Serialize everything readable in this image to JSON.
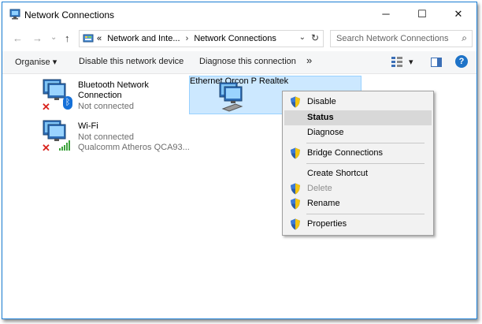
{
  "window": {
    "title": "Network Connections",
    "minimize": "─",
    "maximize": "☐",
    "close": "✕"
  },
  "nav": {
    "back": "←",
    "forward": "→",
    "dropdown": "⌄",
    "up": "↑"
  },
  "address": {
    "overflow": "«",
    "crumbs": [
      "Network and Inte...",
      "Network Connections"
    ],
    "separator": "›",
    "dropdown": "⌄",
    "refresh": "↻"
  },
  "search": {
    "placeholder": "Search Network Connections",
    "icon": "search-icon"
  },
  "toolbar": {
    "organise": "Organise ▾",
    "disable": "Disable this network device",
    "diagnose": "Diagnose this connection",
    "more": "»",
    "view_dd": "▾",
    "help": "?"
  },
  "items": [
    {
      "name": [
        "Bluetooth Network",
        "Connection"
      ],
      "status": "Not connected",
      "device": ""
    },
    {
      "name": [
        "Wi-Fi"
      ],
      "status": "Not connected",
      "device": "Qualcomm Atheros QCA93..."
    },
    {
      "name": [
        "Ethernet"
      ],
      "status": "Orcon P",
      "device": "Realtek"
    }
  ],
  "context_menu": {
    "items": [
      {
        "label": "Disable",
        "shield": true,
        "state": "normal"
      },
      {
        "label": "Status",
        "shield": false,
        "state": "bold-highlighted"
      },
      {
        "label": "Diagnose",
        "shield": false,
        "state": "normal"
      },
      {
        "label": "Bridge Connections",
        "shield": true,
        "state": "normal"
      },
      {
        "label": "Create Shortcut",
        "shield": false,
        "state": "normal"
      },
      {
        "label": "Delete",
        "shield": true,
        "state": "disabled"
      },
      {
        "label": "Rename",
        "shield": true,
        "state": "normal"
      },
      {
        "label": "Properties",
        "shield": true,
        "state": "normal"
      }
    ]
  },
  "colors": {
    "accent": "#1c7fd6",
    "selection": "#cce8ff",
    "help": "#1e73c8"
  }
}
